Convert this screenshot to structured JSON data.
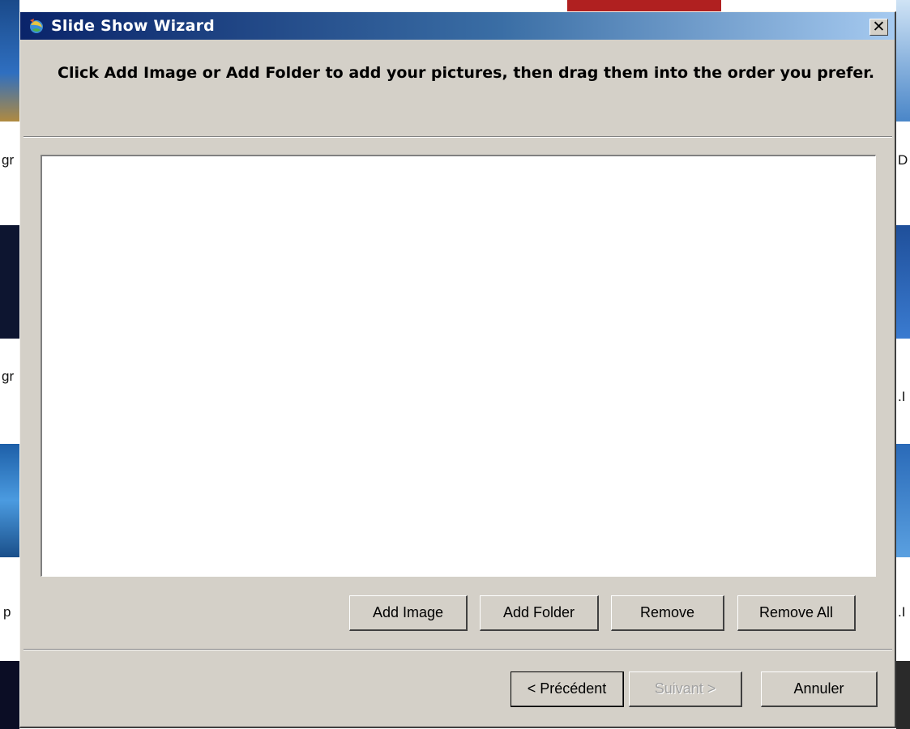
{
  "window": {
    "title": "Slide Show Wizard",
    "close_glyph": "✕",
    "icon": "photo-wizard-icon"
  },
  "header": {
    "instruction": "Click Add Image or Add Folder to add your pictures, then drag them into the order you prefer."
  },
  "image_list": {
    "items": []
  },
  "list_buttons": {
    "add_image": "Add Image",
    "add_folder": "Add Folder",
    "remove": "Remove",
    "remove_all": "Remove All"
  },
  "wizard_buttons": {
    "back": "< Précédent",
    "next": "Suivant >",
    "cancel": "Annuler",
    "next_enabled": false
  },
  "background_fragments": {
    "left": [
      "gr",
      "gr",
      "p"
    ],
    "right": [
      "D",
      ".I",
      ".I"
    ]
  },
  "colors": {
    "titlebar_start": "#0a246a",
    "titlebar_end": "#a6caf0",
    "dialog_face": "#d4d0c8"
  }
}
